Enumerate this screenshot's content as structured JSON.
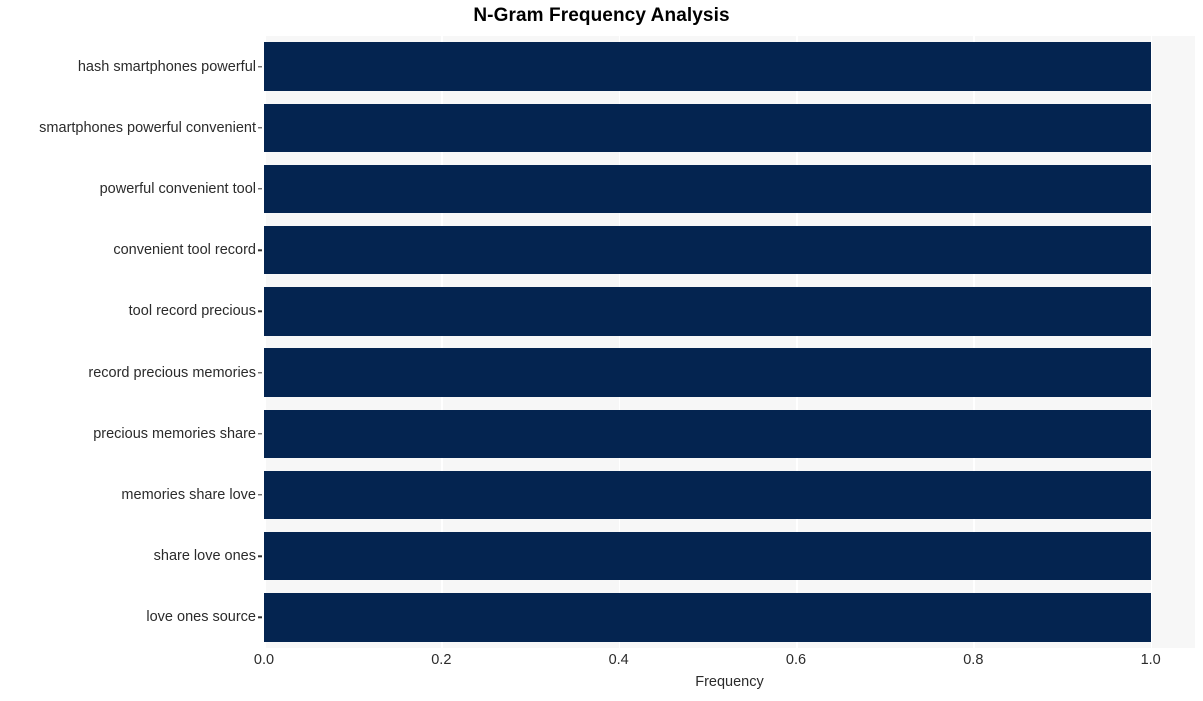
{
  "chart_data": {
    "type": "bar",
    "orientation": "horizontal",
    "title": "N-Gram Frequency Analysis",
    "xlabel": "Frequency",
    "ylabel": "",
    "categories": [
      "hash smartphones powerful",
      "smartphones powerful convenient",
      "powerful convenient tool",
      "convenient tool record",
      "tool record precious",
      "record precious memories",
      "precious memories share",
      "memories share love",
      "share love ones",
      "love ones source"
    ],
    "values": [
      1.0,
      1.0,
      1.0,
      1.0,
      1.0,
      1.0,
      1.0,
      1.0,
      1.0,
      1.0
    ],
    "xlim": [
      0.0,
      1.05
    ],
    "xticks": [
      0.0,
      0.2,
      0.4,
      0.6,
      0.8,
      1.0
    ],
    "xticklabels": [
      "0.0",
      "0.2",
      "0.4",
      "0.6",
      "0.8",
      "1.0"
    ],
    "grid": true,
    "grid_axis": "x",
    "legend": false,
    "bar_color": "#042450",
    "plot_background": "#f7f7f7",
    "grid_color": "#ffffff",
    "figure_background": "#ffffff",
    "text_color": "#2b2b2b",
    "title_color": "#000000"
  }
}
